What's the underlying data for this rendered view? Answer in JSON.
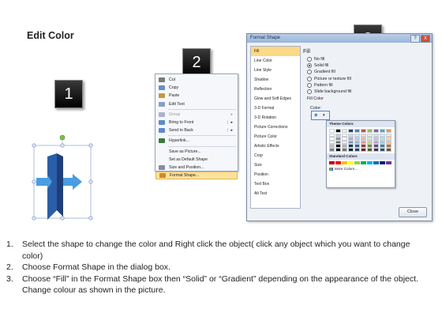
{
  "slide": {
    "title": "Edit Color"
  },
  "badges": [
    "1",
    "2",
    "3"
  ],
  "context_menu": {
    "items": [
      {
        "label": "Cut",
        "icon": "scissors-icon",
        "color": "#7a7a7a"
      },
      {
        "label": "Copy",
        "icon": "copy-icon",
        "color": "#6a8ec6"
      },
      {
        "label": "Paste",
        "icon": "paste-icon",
        "color": "#c49a3c"
      },
      {
        "label": "Edit Text",
        "icon": "edit-text-icon",
        "color": "#8aa0c0"
      },
      {
        "label": "Group",
        "icon": "group-icon",
        "color": "#a8b4c8",
        "submenu": true,
        "disabled": true
      },
      {
        "label": "Bring to Front",
        "icon": "bring-front-icon",
        "color": "#5d8ad0",
        "submenu": true
      },
      {
        "label": "Send to Back",
        "icon": "send-back-icon",
        "color": "#5d8ad0",
        "submenu": true
      },
      {
        "label": "Hyperlink...",
        "icon": "hyperlink-icon",
        "color": "#3a7a3a"
      },
      {
        "label": "Save as Picture...",
        "icon": "",
        "color": ""
      },
      {
        "label": "Set as Default Shape",
        "icon": "",
        "color": ""
      },
      {
        "label": "Size and Position...",
        "icon": "size-position-icon",
        "color": "#8a8aa0"
      },
      {
        "label": "Format Shape...",
        "icon": "format-shape-icon",
        "color": "#d08a2a",
        "highlighted": true
      }
    ]
  },
  "dialog": {
    "title": "Format Shape",
    "help": "?",
    "close_x": "X",
    "nav": [
      "Fill",
      "Line Color",
      "Line Style",
      "Shadow",
      "Reflection",
      "Glow and Soft Edges",
      "3-D Format",
      "3-D Rotation",
      "Picture Corrections",
      "Picture Color",
      "Artistic Effects",
      "Crop",
      "Size",
      "Position",
      "Text Box",
      "Alt Text"
    ],
    "nav_selected": 0,
    "pane_title": "Fill",
    "options": [
      "No fill",
      "Solid fill",
      "Gradient fill",
      "Picture or texture fill",
      "Pattern fill",
      "Slide background fill"
    ],
    "option_selected": 1,
    "fill_color_label": "Fill Color",
    "color_label": "Color:",
    "transparency_label": "Transpa",
    "close_button": "Close"
  },
  "palette": {
    "theme_label": "Theme Colors",
    "standard_label": "Standard Colors",
    "more_colors": "More Colors...",
    "theme_top": [
      "#ffffff",
      "#000000",
      "#eeece1",
      "#1f497d",
      "#4f81bd",
      "#c0504d",
      "#9bbb59",
      "#8064a2",
      "#4bacc6",
      "#f79646"
    ],
    "standard": [
      "#c00000",
      "#ff0000",
      "#ffc000",
      "#ffff00",
      "#92d050",
      "#00b050",
      "#00b0f0",
      "#0070c0",
      "#002060",
      "#7030a0"
    ]
  },
  "instructions": [
    {
      "num": "1.",
      "text": "Select the shape to change the color and Right click the object( click any object which you want to change color)"
    },
    {
      "num": "2.",
      "text": "Choose Format Shape in the dialog box."
    },
    {
      "num": "3.",
      "text": "Choose “Fill” in the Format Shape box then “Solid” or “Gradient” depending on the appearance of the object. Change colour as shown in the picture."
    }
  ]
}
